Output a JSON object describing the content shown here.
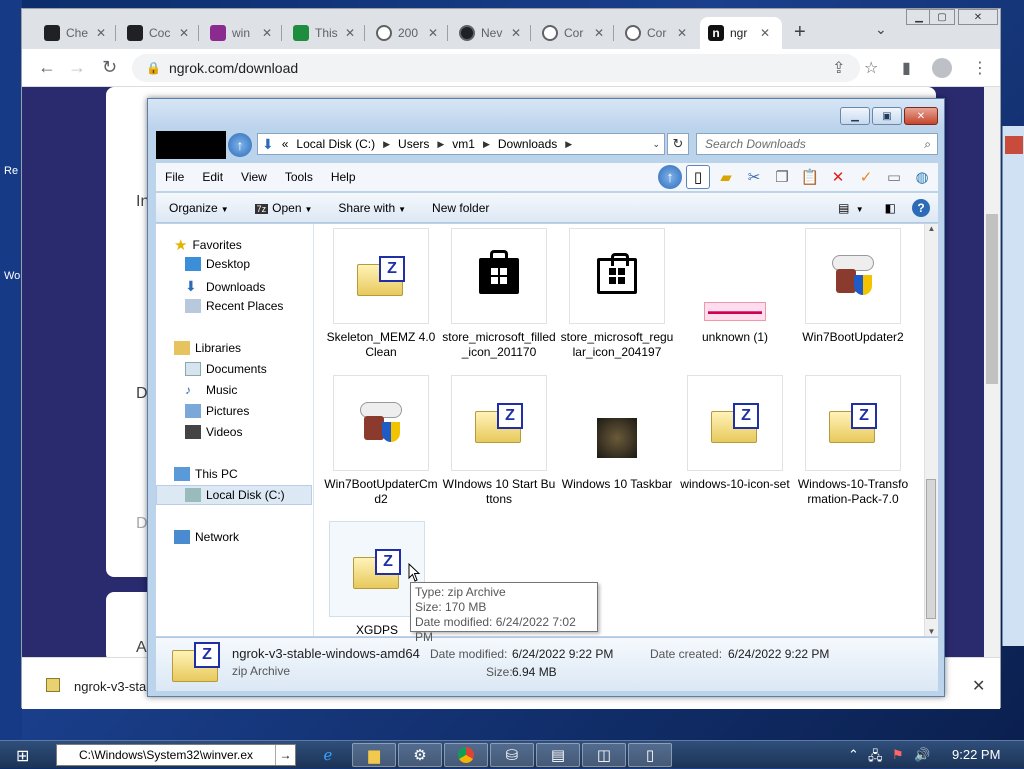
{
  "desktop": {
    "icon_label_1": "Re",
    "icon_label_2": "Wo"
  },
  "browser": {
    "tabs": [
      {
        "label": "Che",
        "icon": "terminal-icon"
      },
      {
        "label": "Coc",
        "icon": "code-icon"
      },
      {
        "label": "win",
        "icon": "doc-icon"
      },
      {
        "label": "This",
        "icon": "green-icon"
      },
      {
        "label": "200",
        "icon": "globe-icon"
      },
      {
        "label": "Nev",
        "icon": "github-icon"
      },
      {
        "label": "Cor",
        "icon": "globe-icon"
      },
      {
        "label": "Cor",
        "icon": "globe-icon"
      },
      {
        "label": "ngr",
        "icon": "ngrok-icon",
        "active": true
      }
    ],
    "new_tab": "+",
    "url": "ngrok.com/download",
    "page_fragments": {
      "a": "In",
      "b": "D",
      "c": "D",
      "d": "A"
    },
    "download_bar": {
      "file_name": "ngrok-v3-stab",
      "close": "✕"
    }
  },
  "explorer": {
    "address": {
      "prefix": "«",
      "segments": [
        "Local Disk (C:)",
        "Users",
        "vm1",
        "Downloads"
      ]
    },
    "search_placeholder": "Search Downloads",
    "menu": [
      "File",
      "Edit",
      "View",
      "Tools",
      "Help"
    ],
    "commands": {
      "organize": "Organize",
      "open": "Open",
      "share_with": "Share with",
      "new_folder": "New folder"
    },
    "nav": {
      "favorites": "Favorites",
      "desktop": "Desktop",
      "downloads": "Downloads",
      "recent_places": "Recent Places",
      "libraries": "Libraries",
      "documents": "Documents",
      "music": "Music",
      "pictures": "Pictures",
      "videos": "Videos",
      "this_pc": "This PC",
      "local_disk": "Local Disk (C:)",
      "network": "Network"
    },
    "files": [
      {
        "name": "Skeleton_MEMZ 4.0 Clean",
        "icon": "zip-icon"
      },
      {
        "name": "store_microsoft_filled_icon_201170",
        "icon": "store-filled-icon"
      },
      {
        "name": "store_microsoft_regular_icon_204197",
        "icon": "store-regular-icon"
      },
      {
        "name": "unknown (1)",
        "icon": "image-icon"
      },
      {
        "name": "Win7BootUpdater2",
        "icon": "installer-icon"
      },
      {
        "name": "Win7BootUpdaterCmd2",
        "icon": "installer-icon"
      },
      {
        "name": "WIndows 10 Start Buttons",
        "icon": "zip-icon"
      },
      {
        "name": "Windows 10 Taskbar",
        "icon": "image-icon"
      },
      {
        "name": "windows-10-icon-set",
        "icon": "zip-icon"
      },
      {
        "name": "Windows-10-Transformation-Pack-7.0",
        "icon": "zip-icon"
      },
      {
        "name": "XGDPS",
        "icon": "zip-icon"
      }
    ],
    "tooltip": {
      "type": "Type: zip Archive",
      "size": "Size: 170 MB",
      "modified": "Date modified: 6/24/2022 7:02 PM"
    },
    "details": {
      "name": "ngrok-v3-stable-windows-amd64",
      "type": "zip Archive",
      "modified_label": "Date modified:",
      "modified_value": "6/24/2022 9:22 PM",
      "created_label": "Date created:",
      "created_value": "6/24/2022 9:22 PM",
      "size_label": "Size:",
      "size_value": "6.94 MB"
    }
  },
  "taskbar": {
    "run_text": "C:\\Windows\\System32\\winver.ex",
    "clock": "9:22 PM"
  }
}
